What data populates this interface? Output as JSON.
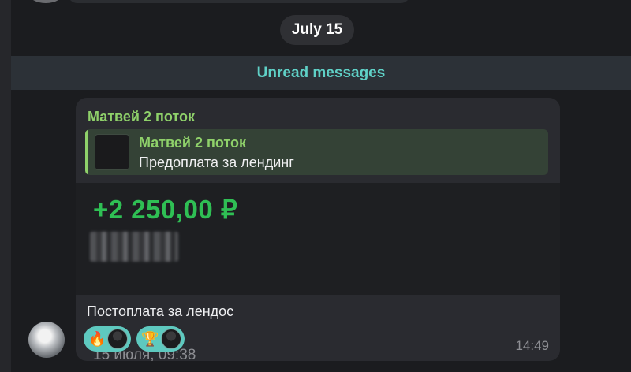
{
  "chat": {
    "date_separator": "July 15",
    "unread_label": "Unread messages"
  },
  "message": {
    "sender_name": "Матвей 2 поток",
    "reply": {
      "name": "Матвей 2 поток",
      "text": "Предоплата за лендинг"
    },
    "embed": {
      "amount": "+2 250,00 ₽",
      "date": "15 июля, 09:38"
    },
    "caption": "Постоплата за лендос",
    "reactions": [
      {
        "emoji": "🔥",
        "icon": "fire-icon"
      },
      {
        "emoji": "🏆",
        "icon": "trophy-icon"
      }
    ],
    "time": "14:49"
  },
  "colors": {
    "background": "#1b1c1f",
    "bubble": "#2a2b30",
    "sender_green": "#8fd16a",
    "amount_green": "#2fbf54",
    "unread_teal": "#5fd0c6",
    "reaction_bg": "#5ec9bf"
  }
}
